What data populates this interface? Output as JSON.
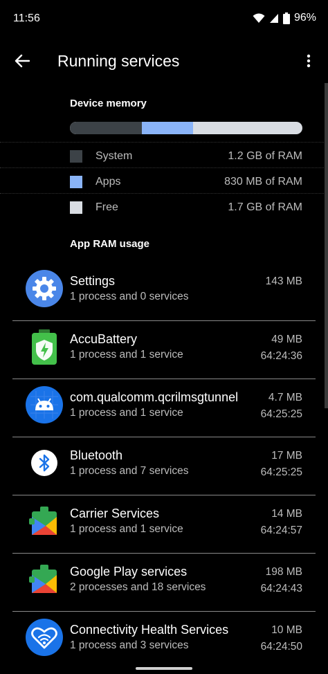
{
  "status_bar": {
    "time": "11:56",
    "battery": "96%",
    "icons": [
      "wifi-icon",
      "signal-icon",
      "battery-icon"
    ]
  },
  "app_bar": {
    "title": "Running services",
    "back_icon": "arrow-back-icon",
    "more_icon": "more-vert-icon"
  },
  "device_memory": {
    "title": "Device memory",
    "usage_fractions": {
      "system": 0.31,
      "apps": 0.22,
      "free": 0.47
    },
    "legend": [
      {
        "label": "System",
        "value": "1.2 GB of RAM",
        "color": "#3c4247"
      },
      {
        "label": "Apps",
        "value": "830 MB of RAM",
        "color": "#8ab4f8"
      },
      {
        "label": "Free",
        "value": "1.7 GB of RAM",
        "color": "#d9dde3"
      }
    ]
  },
  "app_ram": {
    "title": "App RAM usage",
    "items": [
      {
        "name": "Settings",
        "detail": "1 process and 0 services",
        "size": "143 MB",
        "time": "",
        "icon": "settings-gear-icon"
      },
      {
        "name": "AccuBattery",
        "detail": "1 process and 1 service",
        "size": "49 MB",
        "time": "64:24:36",
        "icon": "accubattery-icon"
      },
      {
        "name": "com.qualcomm.qcrilmsgtunnel",
        "detail": "1 process and 1 service",
        "size": "4.7 MB",
        "time": "64:25:25",
        "icon": "android-robot-icon"
      },
      {
        "name": "Bluetooth",
        "detail": "1 process and 7 services",
        "size": "17 MB",
        "time": "64:25:25",
        "icon": "bluetooth-icon"
      },
      {
        "name": "Carrier Services",
        "detail": "1 process and 1 service",
        "size": "14 MB",
        "time": "64:24:57",
        "icon": "carrier-services-icon"
      },
      {
        "name": "Google Play services",
        "detail": "2 processes and 18 services",
        "size": "198 MB",
        "time": "64:24:43",
        "icon": "google-play-services-icon"
      },
      {
        "name": "Connectivity Health Services",
        "detail": "1 process and 3 services",
        "size": "10 MB",
        "time": "64:24:50",
        "icon": "connectivity-health-icon"
      }
    ]
  }
}
